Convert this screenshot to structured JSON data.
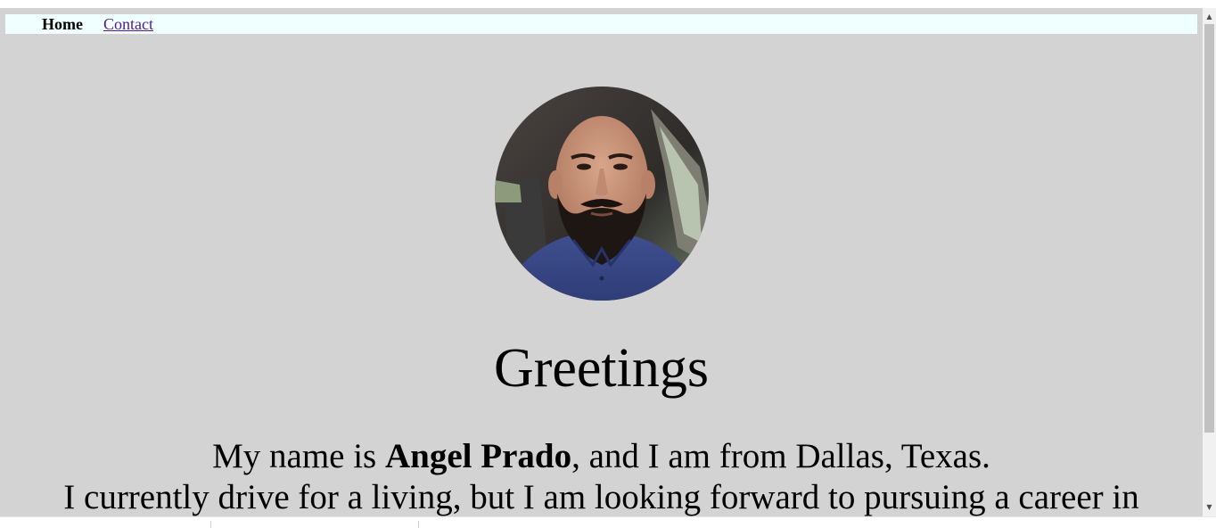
{
  "nav": {
    "home_label": "Home",
    "contact_label": "Contact"
  },
  "profile": {
    "photo_alt": "Profile photo"
  },
  "main": {
    "heading": "Greetings",
    "bio_line1_prefix": "My name is ",
    "bio_name": "Angel Prado",
    "bio_line1_suffix": ", and I am from Dallas, Texas.",
    "bio_line2": "I currently drive for a living, but I am looking forward to pursuing a career in"
  },
  "colors": {
    "page_background": "#d3d3d3",
    "navbar_background": "#f0ffff",
    "visited_link": "#551a8b"
  }
}
